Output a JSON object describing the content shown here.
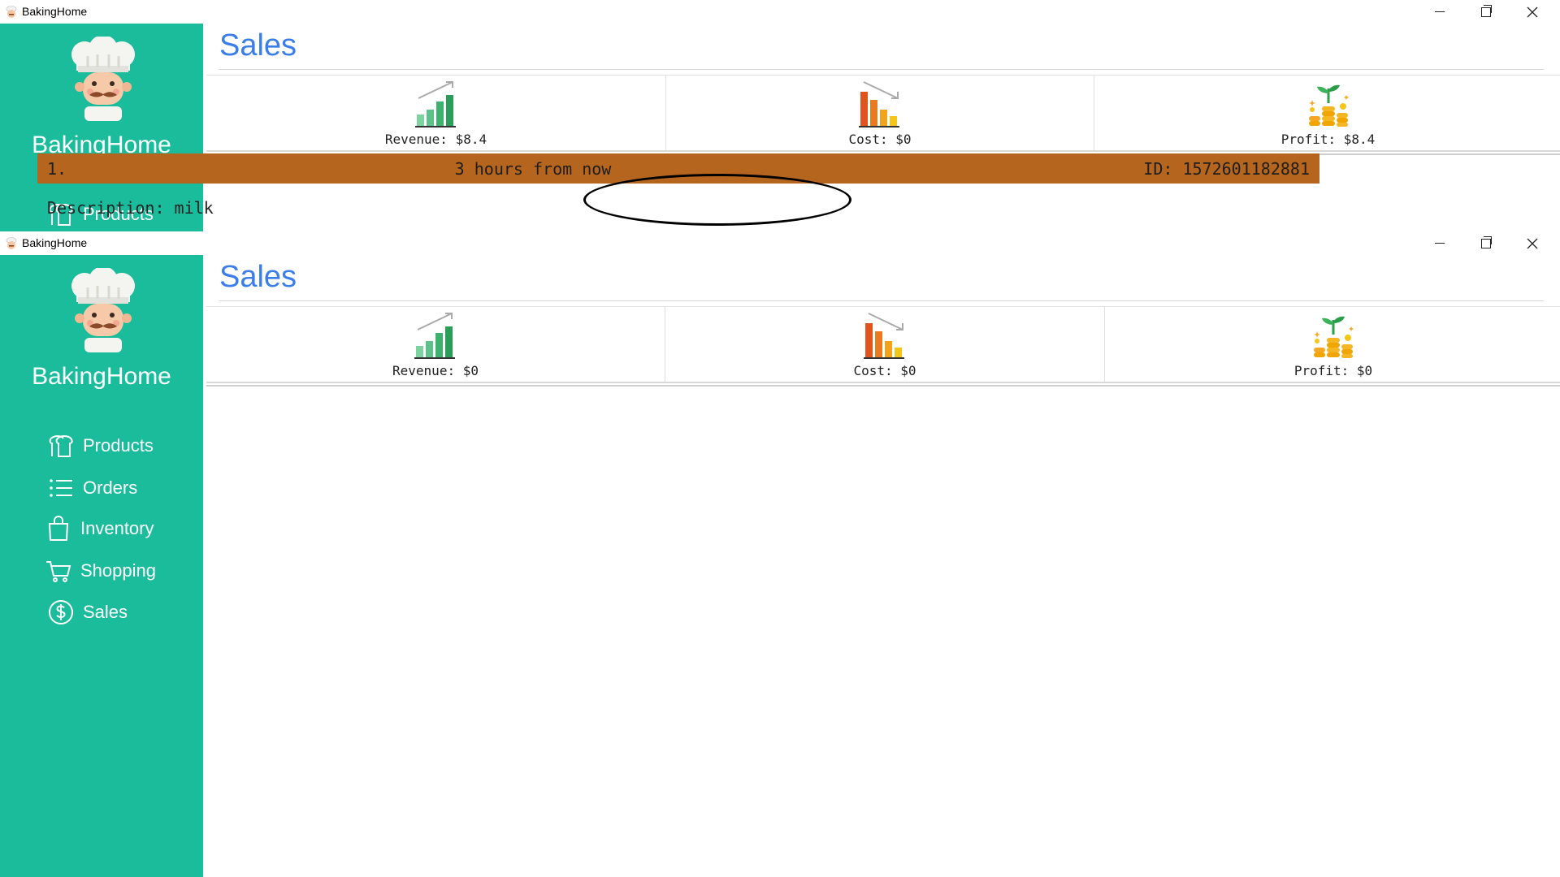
{
  "windows": [
    {
      "title": "BakingHome",
      "sidebar": {
        "brand": "BakingHome",
        "items": [
          {
            "label": "Products",
            "icon": "bread-icon"
          }
        ]
      },
      "page_title": "Sales",
      "cards": {
        "revenue": "Revenue: $8.4",
        "cost": "Cost: $0",
        "profit": "Profit: $8.4"
      },
      "order": {
        "number": "1.",
        "time": "3 hours from now",
        "id": "ID: 1572601182881",
        "description": "Description: milk"
      }
    },
    {
      "title": "BakingHome",
      "sidebar": {
        "brand": "BakingHome",
        "items": [
          {
            "label": "Products",
            "icon": "bread-icon"
          },
          {
            "label": "Orders",
            "icon": "list-icon"
          },
          {
            "label": "Inventory",
            "icon": "bag-icon"
          },
          {
            "label": "Shopping",
            "icon": "cart-icon"
          },
          {
            "label": "Sales",
            "icon": "dollar-circle-icon"
          }
        ]
      },
      "page_title": "Sales",
      "cards": {
        "revenue": "Revenue: $0",
        "cost": "Cost: $0",
        "profit": "Profit: $0"
      }
    }
  ],
  "colors": {
    "sidebar": "#1abc9c",
    "title_blue": "#3b7de9",
    "order_header": "#b5651d"
  }
}
